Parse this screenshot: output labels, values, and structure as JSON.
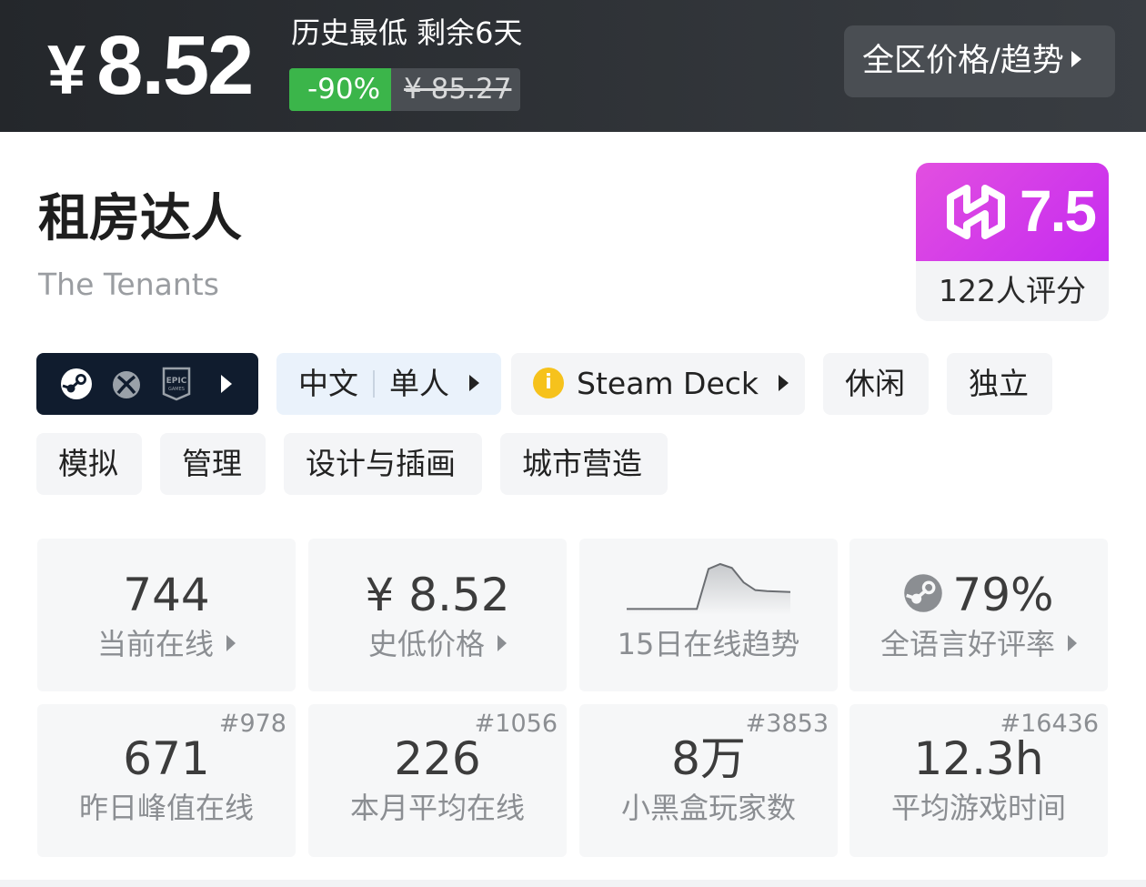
{
  "price_bar": {
    "currency": "¥",
    "current_price": "8.52",
    "note": "历史最低 剩余6天",
    "discount": "-90%",
    "original_price": "¥ 85.27",
    "trend_button": "全区价格/趋势"
  },
  "game": {
    "title_zh": "租房达人",
    "title_en": "The Tenants"
  },
  "rating": {
    "score": "7.5",
    "count_label": "122人评分",
    "colors": {
      "gradient_start": "#e24fe0",
      "gradient_end": "#c62bf0"
    }
  },
  "tags": {
    "platforms": [
      "steam-icon",
      "xbox-icon",
      "epic-games-icon"
    ],
    "language": "中文",
    "mode": "单人",
    "steam_deck": "Steam Deck",
    "genres": [
      "休闲",
      "独立",
      "模拟",
      "管理",
      "设计与插画",
      "城市营造"
    ]
  },
  "stats": {
    "current_online": {
      "value": "744",
      "label": "当前在线"
    },
    "lowest_price": {
      "value": "¥ 8.52",
      "label": "史低价格"
    },
    "trend": {
      "label": "15日在线趋势",
      "points": [
        5,
        5,
        5,
        5,
        5,
        5,
        5,
        88,
        98,
        90,
        60,
        44,
        42,
        41,
        40
      ]
    },
    "positive_rate": {
      "value": "79%",
      "label": "全语言好评率"
    },
    "yesterday_peak": {
      "value": "671",
      "label": "昨日峰值在线",
      "rank": "#978"
    },
    "monthly_avg": {
      "value": "226",
      "label": "本月平均在线",
      "rank": "#1056"
    },
    "players": {
      "value": "8万",
      "label": "小黑盒玩家数",
      "rank": "#3853"
    },
    "avg_playtime": {
      "value": "12.3h",
      "label": "平均游戏时间",
      "rank": "#16436"
    }
  },
  "colors": {
    "discount_green": "#3bb54a",
    "platform_tag_bg": "#101c2e",
    "steam_deck_info": "#f6c21c"
  }
}
